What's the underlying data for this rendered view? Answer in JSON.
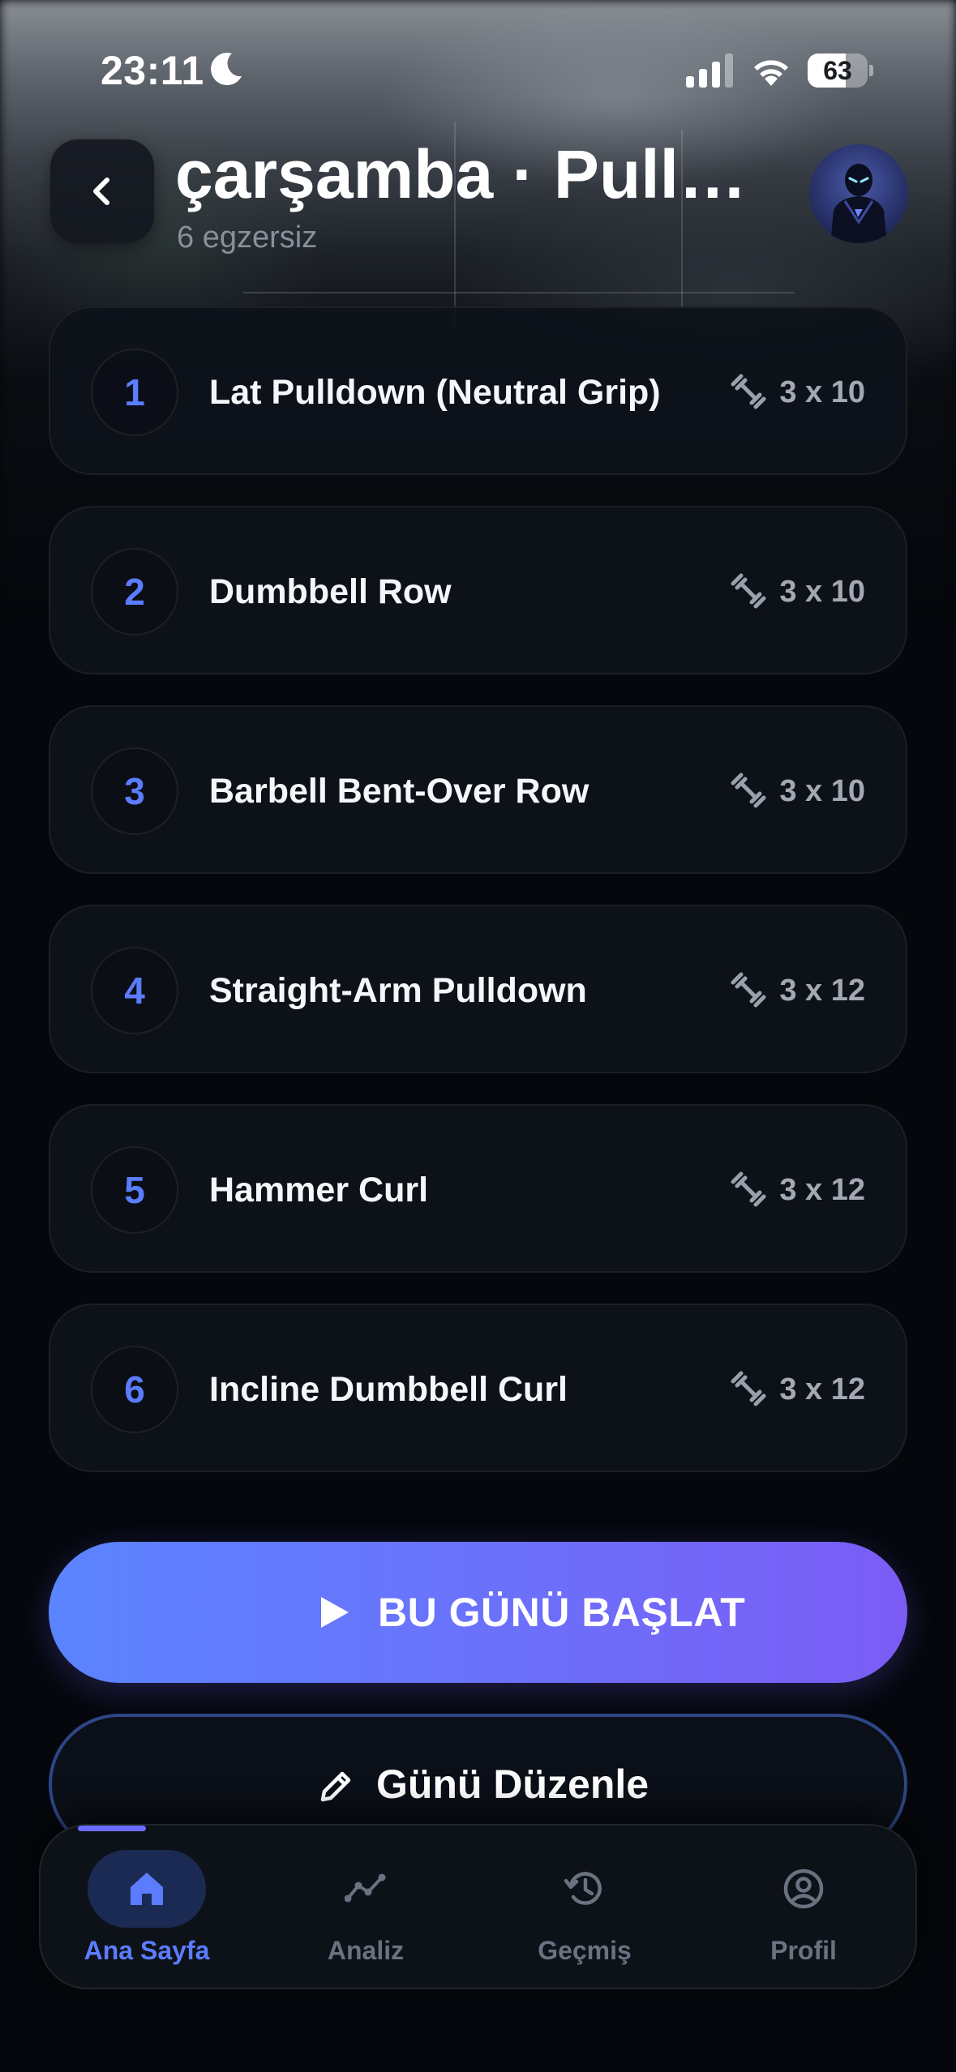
{
  "status_bar": {
    "time": "23:11",
    "battery_level": "63",
    "battery_fraction": 0.63
  },
  "header": {
    "title": "çarşamba · Pull…",
    "subtitle": "6 egzersiz"
  },
  "exercises": [
    {
      "number": "1",
      "name": "Lat Pulldown (Neutral Grip)",
      "sets": "3 x 10"
    },
    {
      "number": "2",
      "name": "Dumbbell Row",
      "sets": "3 x 10"
    },
    {
      "number": "3",
      "name": "Barbell Bent-Over Row",
      "sets": "3 x 10"
    },
    {
      "number": "4",
      "name": "Straight-Arm Pulldown",
      "sets": "3 x 12"
    },
    {
      "number": "5",
      "name": "Hammer Curl",
      "sets": "3 x 12"
    },
    {
      "number": "6",
      "name": "Incline Dumbbell Curl",
      "sets": "3 x 12"
    }
  ],
  "actions": {
    "start_label": "BU GÜNÜ BAŞLAT",
    "edit_label": "Günü Düzenle"
  },
  "tab_bar": {
    "tabs": [
      {
        "label": "Ana Sayfa",
        "icon": "home-icon",
        "active": true
      },
      {
        "label": "Analiz",
        "icon": "chart-line-icon",
        "active": false
      },
      {
        "label": "Geçmiş",
        "icon": "history-icon",
        "active": false
      },
      {
        "label": "Profil",
        "icon": "profile-icon",
        "active": false
      }
    ]
  },
  "colors": {
    "accent": "#5b7cff",
    "gradient_start": "#5b84ff",
    "gradient_end": "#7b5cf5",
    "background": "#05070c",
    "card": "#0e121a"
  }
}
